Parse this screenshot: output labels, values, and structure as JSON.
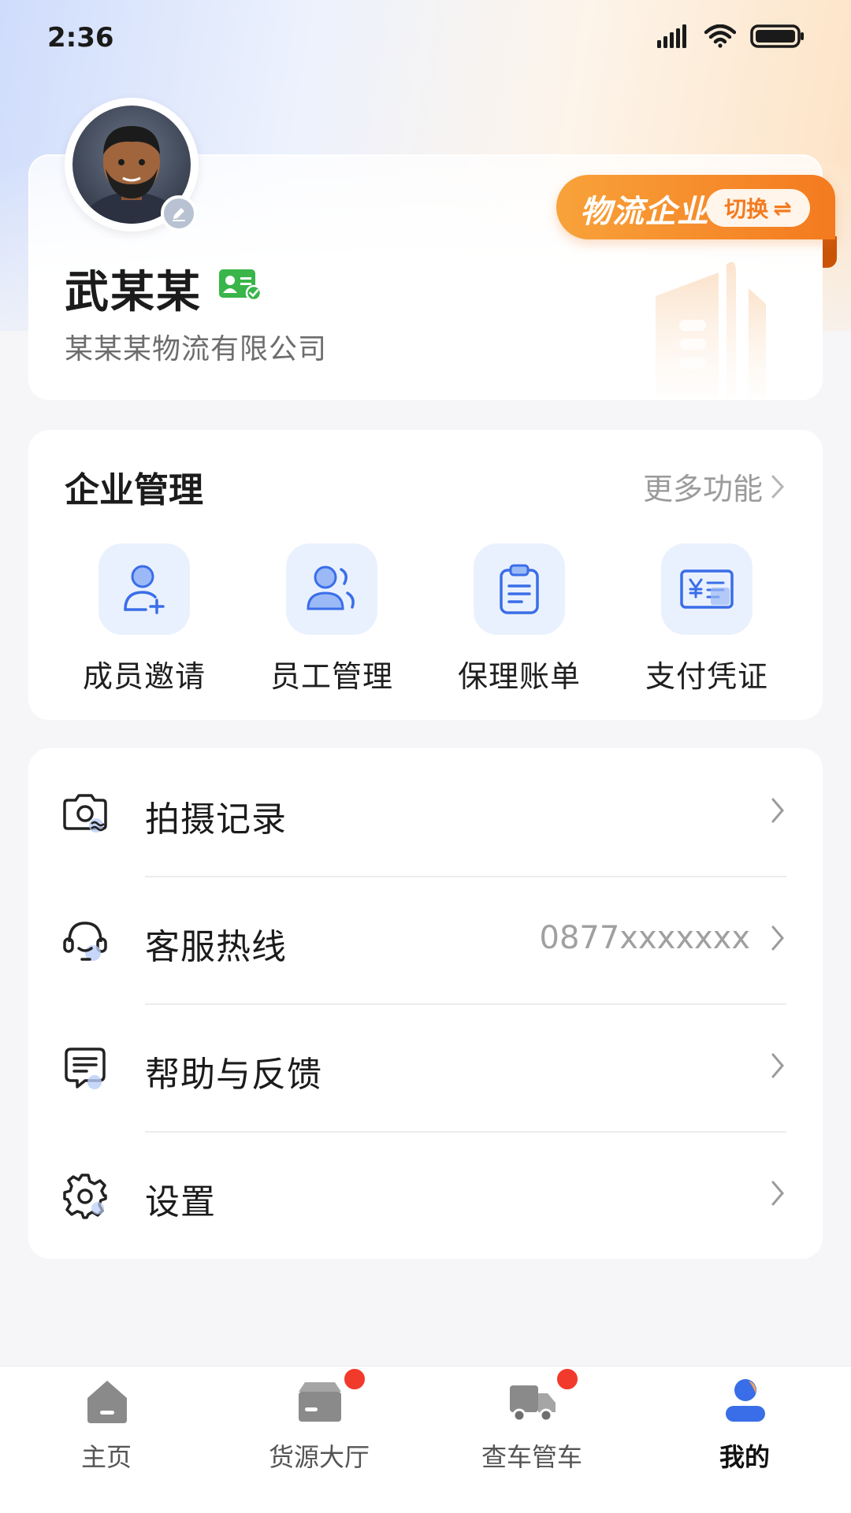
{
  "status_bar": {
    "time": "2:36"
  },
  "profile": {
    "name": "武某某",
    "company": "某某某物流有限公司",
    "role_label": "物流企业",
    "switch_label": "切换",
    "switch_icon": "⇌"
  },
  "enterprise": {
    "title": "企业管理",
    "more_label": "更多功能",
    "items": [
      {
        "label": "成员邀请",
        "icon": "user-add-icon"
      },
      {
        "label": "员工管理",
        "icon": "users-icon"
      },
      {
        "label": "保理账单",
        "icon": "clipboard-icon"
      },
      {
        "label": "支付凭证",
        "icon": "voucher-icon"
      }
    ]
  },
  "menu": {
    "items": [
      {
        "label": "拍摄记录",
        "value": "",
        "icon": "camera-icon"
      },
      {
        "label": "客服热线",
        "value": "0877xxxxxxx",
        "icon": "headset-icon"
      },
      {
        "label": "帮助与反馈",
        "value": "",
        "icon": "message-icon"
      },
      {
        "label": "设置",
        "value": "",
        "icon": "gear-icon"
      }
    ]
  },
  "tabs": [
    {
      "label": "主页",
      "icon": "home-icon",
      "badge": false,
      "active": false
    },
    {
      "label": "货源大厅",
      "icon": "cargo-icon",
      "badge": true,
      "active": false
    },
    {
      "label": "查车管车",
      "icon": "truck-icon",
      "badge": true,
      "active": false
    },
    {
      "label": "我的",
      "icon": "profile-icon",
      "badge": false,
      "active": true
    }
  ],
  "colors": {
    "accent_orange": "#f47a1f",
    "accent_blue": "#3a6ee8",
    "badge_red": "#f23a2c"
  }
}
